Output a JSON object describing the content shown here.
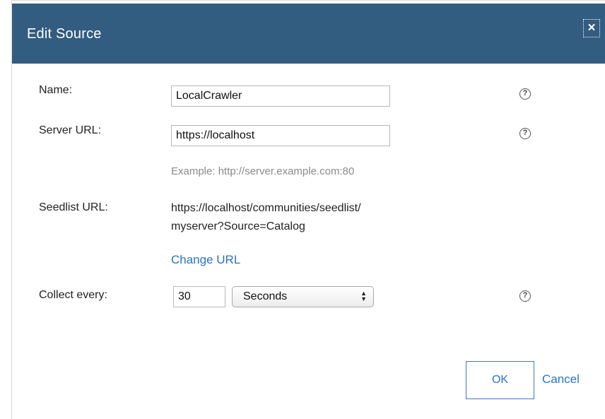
{
  "dialog": {
    "title": "Edit Source",
    "close_label": "×"
  },
  "form": {
    "name_label": "Name:",
    "name_value": "LocalCrawler",
    "server_url_label": "Server URL:",
    "server_url_value": "https://localhost",
    "server_url_hint": "Example: http://server.example.com:80",
    "seedlist_url_label": "Seedlist URL:",
    "seedlist_url_line1": "https://localhost/communities/seedlist/",
    "seedlist_url_line2": "myserver?Source=Catalog",
    "change_url_link": "Change URL",
    "collect_every_label": "Collect every:",
    "collect_every_value": "30",
    "collect_unit_selected": "Seconds",
    "help_icon_glyph": "?"
  },
  "footer": {
    "ok_label": "OK",
    "cancel_label": "Cancel"
  },
  "colors": {
    "header_bg": "#325c80",
    "link": "#2a72c8",
    "hint": "#8a8a8a"
  }
}
